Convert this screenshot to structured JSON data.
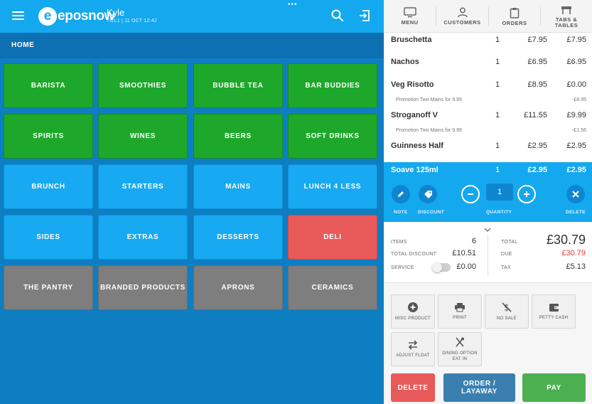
{
  "header": {
    "logo_text": "eposnow",
    "user_name": "Kyle",
    "till_info": "TILL1 | 11 OCT 12:42",
    "dots": "•••"
  },
  "breadcrumb": "HOME",
  "categories": [
    {
      "label": "BARISTA",
      "color": "green"
    },
    {
      "label": "SMOOTHIES",
      "color": "green"
    },
    {
      "label": "BUBBLE TEA",
      "color": "green"
    },
    {
      "label": "BAR BUDDIES",
      "color": "green"
    },
    {
      "label": "SPIRITS",
      "color": "green"
    },
    {
      "label": "WINES",
      "color": "green"
    },
    {
      "label": "BEERS",
      "color": "green"
    },
    {
      "label": "SOFT DRINKS",
      "color": "green"
    },
    {
      "label": "BRUNCH",
      "color": "blue"
    },
    {
      "label": "STARTERS",
      "color": "blue"
    },
    {
      "label": "MAINS",
      "color": "blue"
    },
    {
      "label": "LUNCH 4 LESS",
      "color": "blue"
    },
    {
      "label": "SIDES",
      "color": "blue"
    },
    {
      "label": "EXTRAS",
      "color": "blue"
    },
    {
      "label": "DESSERTS",
      "color": "blue"
    },
    {
      "label": "DELI",
      "color": "red"
    },
    {
      "label": "THE PANTRY",
      "color": "grey"
    },
    {
      "label": "BRANDED PRODUCTS",
      "color": "grey"
    },
    {
      "label": "APRONS",
      "color": "grey"
    },
    {
      "label": "CERAMICS",
      "color": "grey"
    }
  ],
  "right_nav": [
    {
      "label": "MENU",
      "icon": "monitor-icon"
    },
    {
      "label": "CUSTOMERS",
      "icon": "person-icon"
    },
    {
      "label": "ORDERS",
      "icon": "clipboard-icon"
    },
    {
      "label": "TABS & TABLES",
      "icon": "table-icon"
    }
  ],
  "order_lines": [
    {
      "name": "Bruschetta",
      "qty": "1",
      "price": "£7.95",
      "total": "£7.95"
    },
    {
      "name": "Nachos",
      "qty": "1",
      "price": "£6.95",
      "total": "£6.95"
    },
    {
      "name": "Veg Risotto",
      "qty": "1",
      "price": "£8.95",
      "total": "£0.00"
    },
    {
      "name": "Stroganoff V",
      "qty": "1",
      "price": "£11.55",
      "total": "£9.99"
    },
    {
      "name": "Guinness Half",
      "qty": "1",
      "price": "£2.95",
      "total": "£2.95"
    }
  ],
  "promotions": [
    {
      "name": "Promotion Two Mains for 9.99",
      "value": "-£8.95"
    },
    {
      "name": "Promotion Two Mains for 9.99",
      "value": "-£1.56"
    }
  ],
  "selected_line": {
    "name": "Soave 125ml",
    "qty": "1",
    "price": "£2.95",
    "total": "£2.95"
  },
  "selected_controls": {
    "note_label": "NOTE",
    "discount_label": "DISCOUNT",
    "quantity_label": "QUANTITY",
    "quantity_value": "1",
    "delete_label": "DELETE"
  },
  "summary": {
    "items_label": "ITEMS",
    "items_value": "6",
    "total_discount_label": "TOTAL DISCOUNT",
    "total_discount_value": "£10.51",
    "service_label": "SERVICE",
    "service_value": "£0.00",
    "total_label": "TOTAL",
    "total_value": "£30.79",
    "due_label": "DUE",
    "due_value": "£30.79",
    "tax_label": "TAX",
    "tax_value": "£5.13"
  },
  "actions": [
    {
      "label": "MISC PRODUCT",
      "icon": "plus-circle-icon"
    },
    {
      "label": "PRINT",
      "icon": "printer-icon"
    },
    {
      "label": "NO SALE",
      "icon": "no-dollar-icon"
    },
    {
      "label": "PETTY CASH",
      "icon": "wallet-icon"
    },
    {
      "label": "ADJUST FLOAT",
      "icon": "swap-icon"
    },
    {
      "label": "DINING OPTION EAT IN",
      "icon": "cutlery-icon"
    }
  ],
  "buttons": {
    "delete": "DELETE",
    "order_layaway": "ORDER / LAYAWAY",
    "pay": "PAY"
  },
  "colors": {
    "accent": "#14a8ef",
    "green": "#1ea82b",
    "red": "#e85a5a",
    "due_red": "#e53935",
    "grey": "#7e7e7e",
    "layaway": "#3a7fb0",
    "pay": "#4caf50"
  }
}
